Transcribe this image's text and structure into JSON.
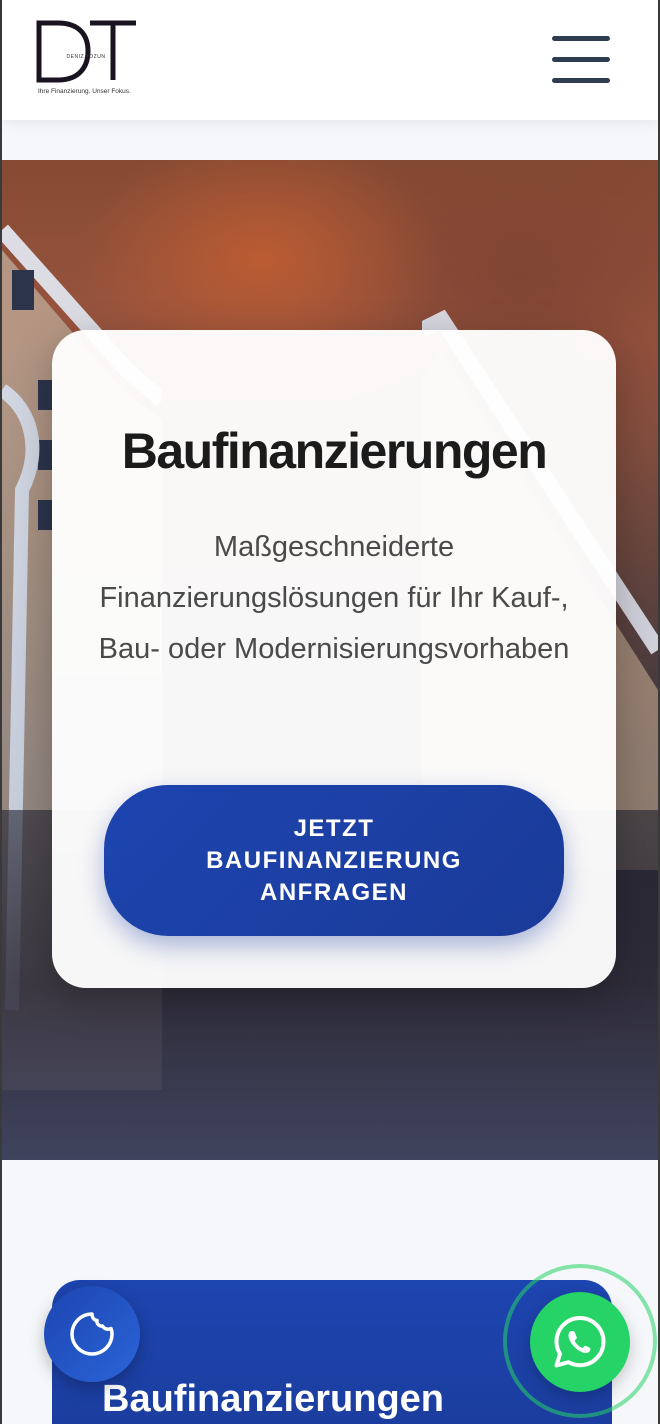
{
  "header": {
    "logo": {
      "letters": "DT",
      "name": "DENIZ TOZUN",
      "tagline": "Ihre Finanzierung. Unser Fokus."
    },
    "menu_icon": "hamburger-menu-icon"
  },
  "hero": {
    "title": "Baufinanzierungen",
    "subtitle": "Maßgeschneiderte Finanzierungslösungen für Ihr Kauf-, Bau- oder Modernisierungsvorhaben",
    "cta_label": "JETZT BAUFINANZIERUNG ANFRAGEN"
  },
  "section": {
    "title": "Baufinanzierungen"
  },
  "floating": {
    "cookie_icon": "cookie-icon",
    "whatsapp_icon": "whatsapp-icon"
  },
  "colors": {
    "brand_blue": "#1d45b0",
    "whatsapp_green": "#25d366",
    "menu_dark": "#2e3d50"
  }
}
